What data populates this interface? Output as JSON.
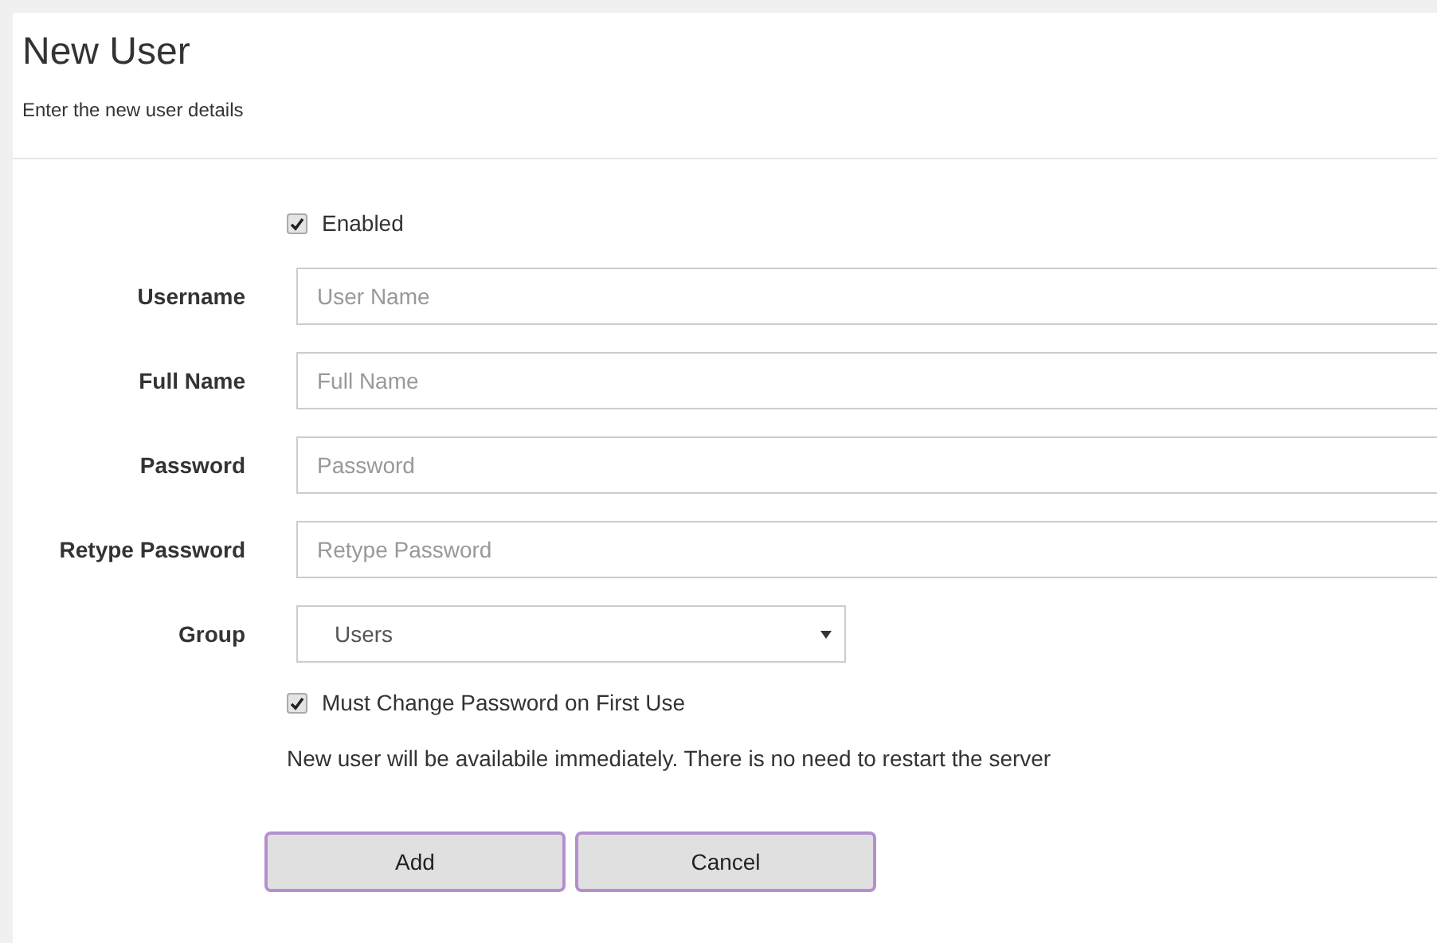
{
  "title": "New User",
  "subtitle": "Enter the new user details",
  "enabled": {
    "label": "Enabled",
    "checked": true
  },
  "fields": [
    {
      "kind": "text",
      "label": "Username",
      "placeholder": "User Name"
    },
    {
      "kind": "text",
      "label": "Full Name",
      "placeholder": "Full Name"
    },
    {
      "kind": "text",
      "label": "Password",
      "placeholder": "Password"
    },
    {
      "kind": "text",
      "label": "Retype Password",
      "placeholder": "Retype Password"
    },
    {
      "kind": "select",
      "label": "Group",
      "value": "Users"
    }
  ],
  "must_change": {
    "label": "Must Change Password on First Use",
    "checked": true
  },
  "note": "New user will be availabile immediately. There is no need to restart the server",
  "buttons": [
    "Add",
    "Cancel"
  ]
}
